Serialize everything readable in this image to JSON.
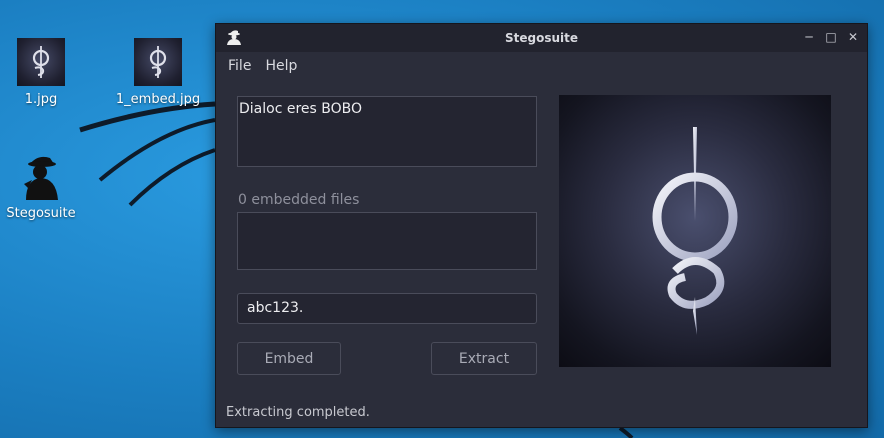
{
  "desktop": {
    "icons": [
      {
        "label": "1.jpg"
      },
      {
        "label": "1_embed.jpg"
      },
      {
        "label": "Stegosuite"
      }
    ]
  },
  "window": {
    "title": "Stegosuite",
    "menu": [
      "File",
      "Help"
    ],
    "message_text": "Dialoc eres BOBO",
    "files_label": "0 embedded files",
    "password_value": "abc123.",
    "embed_label": "Embed",
    "extract_label": "Extract",
    "status": "Extracting completed."
  },
  "colors": {
    "desktop": "#1b7fc2",
    "window_bg": "#2b2d3a",
    "titlebar": "#22232e"
  }
}
